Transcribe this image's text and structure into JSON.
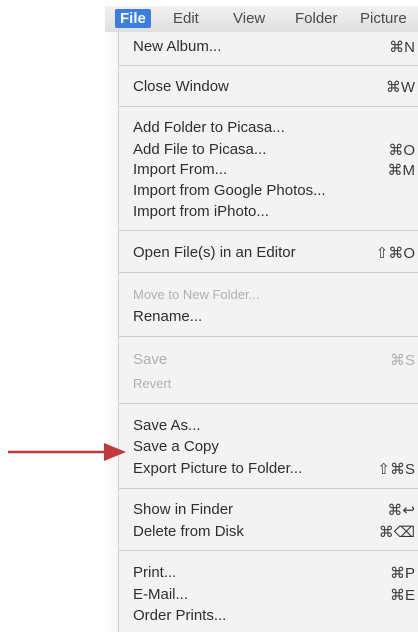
{
  "menubar": {
    "items": [
      {
        "label": "File",
        "active": true
      },
      {
        "label": "Edit"
      },
      {
        "label": "View"
      },
      {
        "label": "Folder"
      },
      {
        "label": "Picture"
      }
    ]
  },
  "menu": {
    "items": [
      {
        "label": "New Album...",
        "shortcut": "⌘N"
      },
      {
        "label": "Close Window",
        "shortcut": "⌘W"
      },
      {
        "label": "Add Folder to Picasa...",
        "shortcut": ""
      },
      {
        "label": "Add File to Picasa...",
        "shortcut": "⌘O"
      },
      {
        "label": "Import From...",
        "shortcut": "⌘M"
      },
      {
        "label": "Import from Google Photos...",
        "shortcut": ""
      },
      {
        "label": "Import from iPhoto...",
        "shortcut": ""
      },
      {
        "label": "Open File(s) in an Editor",
        "shortcut": "⇧⌘O"
      },
      {
        "label": "Move to New Folder...",
        "shortcut": "",
        "disabled": true
      },
      {
        "label": "Rename...",
        "shortcut": ""
      },
      {
        "label": "Save",
        "shortcut": "⌘S",
        "disabled": true
      },
      {
        "label": "Revert",
        "shortcut": "",
        "disabled": true
      },
      {
        "label": "Save As...",
        "shortcut": ""
      },
      {
        "label": "Save a Copy",
        "shortcut": ""
      },
      {
        "label": "Export Picture to Folder...",
        "shortcut": "⇧⌘S"
      },
      {
        "label": "Show in Finder",
        "shortcut": "⌘↩"
      },
      {
        "label": "Delete from Disk",
        "shortcut": "⌘⌫"
      },
      {
        "label": "Print...",
        "shortcut": "⌘P"
      },
      {
        "label": "E-Mail...",
        "shortcut": "⌘E"
      },
      {
        "label": "Order Prints...",
        "shortcut": ""
      }
    ]
  },
  "annotation": {
    "arrow_color": "#c0393b",
    "points_to": "Save a Copy"
  }
}
